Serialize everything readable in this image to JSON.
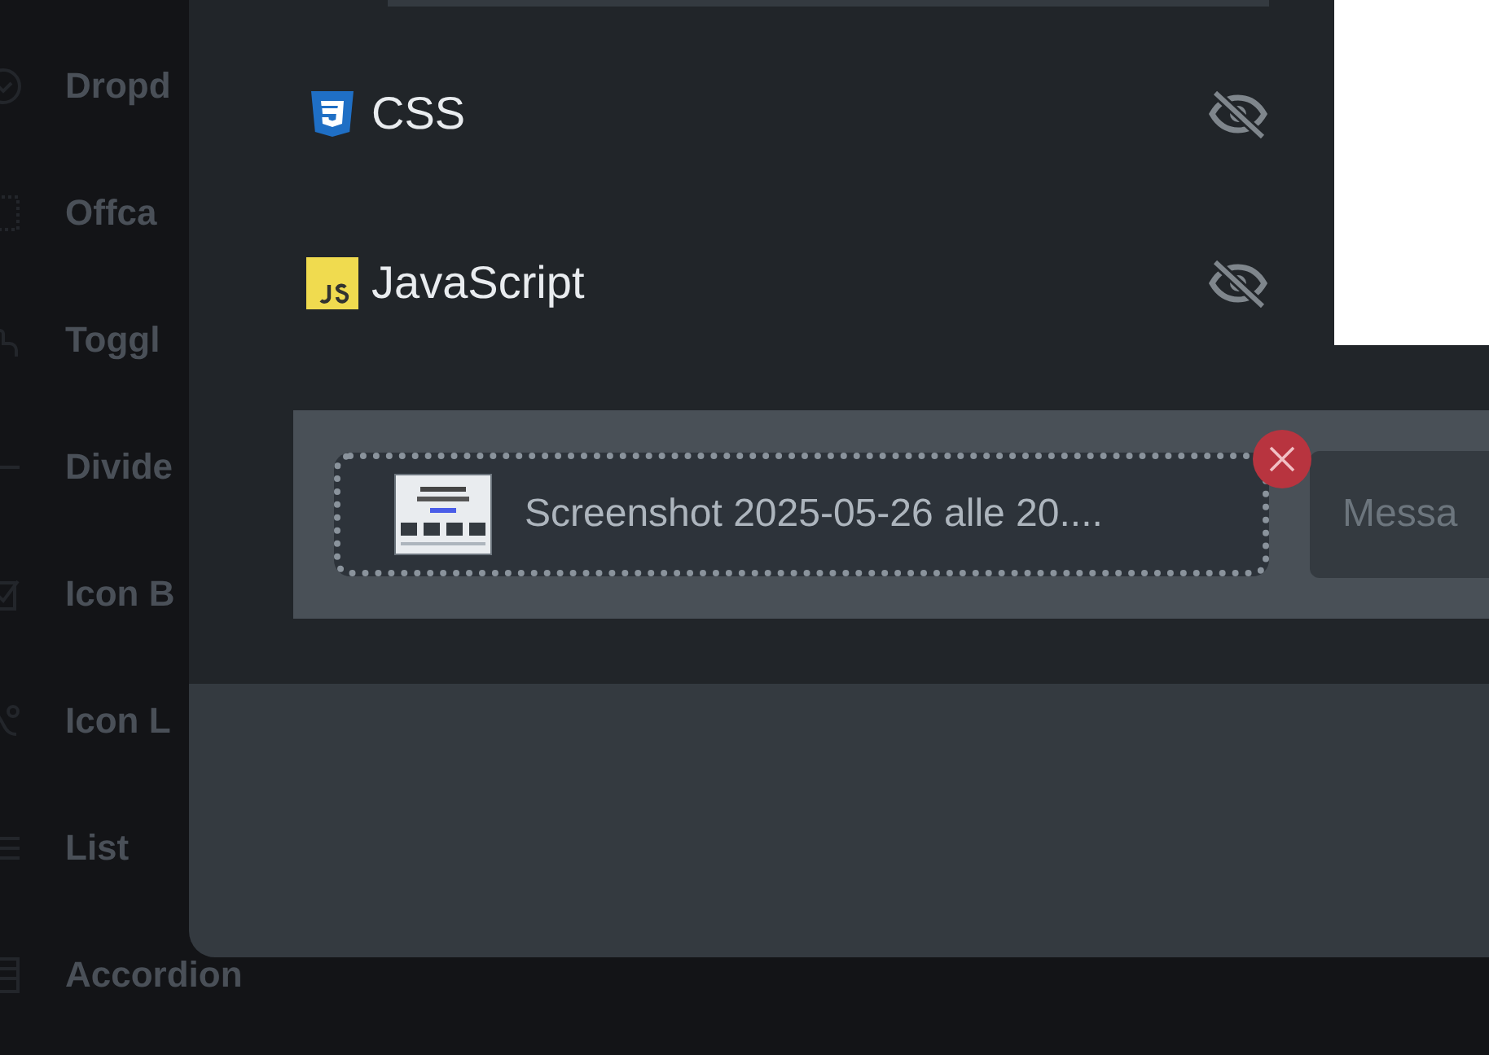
{
  "sidebar": {
    "items": [
      {
        "label": "Dropd"
      },
      {
        "label": "Offca"
      },
      {
        "label": "Toggl"
      },
      {
        "label": "Divide"
      },
      {
        "label": "Icon B"
      },
      {
        "label": "Icon L"
      },
      {
        "label": "List"
      },
      {
        "label": "Accordion"
      }
    ]
  },
  "languages": [
    {
      "name": "CSS",
      "kind": "css",
      "hidden": true
    },
    {
      "name": "JavaScript",
      "kind": "js",
      "hidden": true
    }
  ],
  "attachment": {
    "filename": "Screenshot 2025-05-26 alle 20...."
  },
  "message_field": {
    "placeholder": "Messa"
  }
}
